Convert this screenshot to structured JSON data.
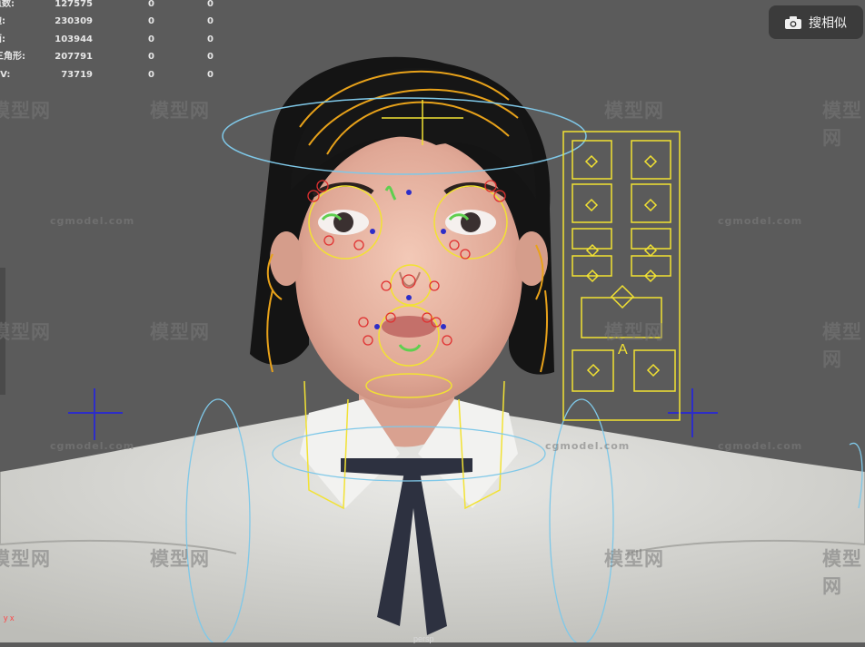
{
  "stats": [
    {
      "label": "点数:",
      "v1": "127575",
      "v2": "0",
      "v3": "0"
    },
    {
      "label": "边:",
      "v1": "230309",
      "v2": "0",
      "v3": "0"
    },
    {
      "label": "面:",
      "v1": "103944",
      "v2": "0",
      "v3": "0"
    },
    {
      "label": "三角形:",
      "v1": "207791",
      "v2": "0",
      "v3": "0"
    },
    {
      "label": "UV:",
      "v1": "73719",
      "v2": "0",
      "v3": "0"
    }
  ],
  "search_button": {
    "label": "搜相似",
    "icon": "camera-icon"
  },
  "watermarks": {
    "cn": "模型网",
    "en": "cgmodel.com"
  },
  "axis_indicator": "y x",
  "camera_label": "persp",
  "colors": {
    "background": "#5b5b5b",
    "rig_yellow": "#f2e233",
    "rig_red": "#e03030",
    "rig_green": "#5fcf4f",
    "rig_blue": "#2d2dc8",
    "rig_cyan": "#7fc8e8",
    "hair_orange": "#e8a21a"
  }
}
